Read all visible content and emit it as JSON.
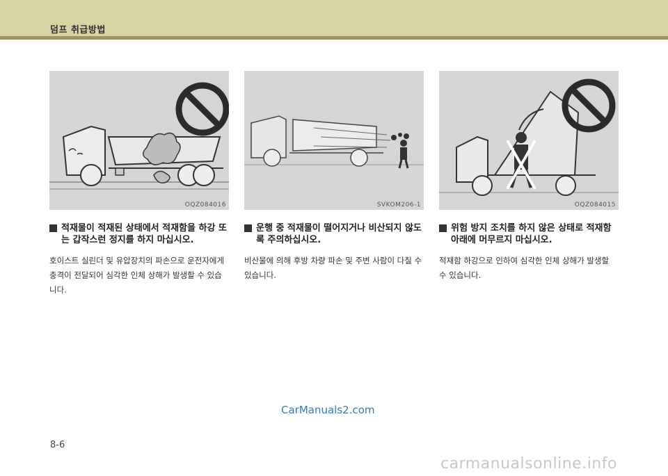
{
  "header": {
    "title": "덤프 취급방법",
    "color": "#d8d3a3",
    "rule_color": "#9c9560"
  },
  "sections": [
    {
      "figure_code": "OQZ084016",
      "heading": "적재물이 적재된 상태에서 적재함을 하강 또는 갑작스런 정지를 하지 마십시오.",
      "body": "호이스트 실린더 및 유압장치의 파손으로 운전자에게 충격이 전달되어 심각한 인체 상해가 발생할 수 있습니다."
    },
    {
      "figure_code": "SVKOM206-1",
      "heading": "운행 중 적재물이 떨어지거나 비산되지 않도록 주의하십시오.",
      "body": "비산물에 의해 후방 차량 파손 및 주변 사람이 다칠 수 있습니다."
    },
    {
      "figure_code": "OQZ084015",
      "heading": "위험 방지 조치를 하지 않은 상태로 적재함 아래에 머무르지 마십시오.",
      "body": "적재함 하강으로 인하여 심각한 인체 상해가 발생할 수 있습니다."
    }
  ],
  "watermark": "CarManuals2.com",
  "page_number": "8-6",
  "footer_watermark": "carmanualsonline.info"
}
